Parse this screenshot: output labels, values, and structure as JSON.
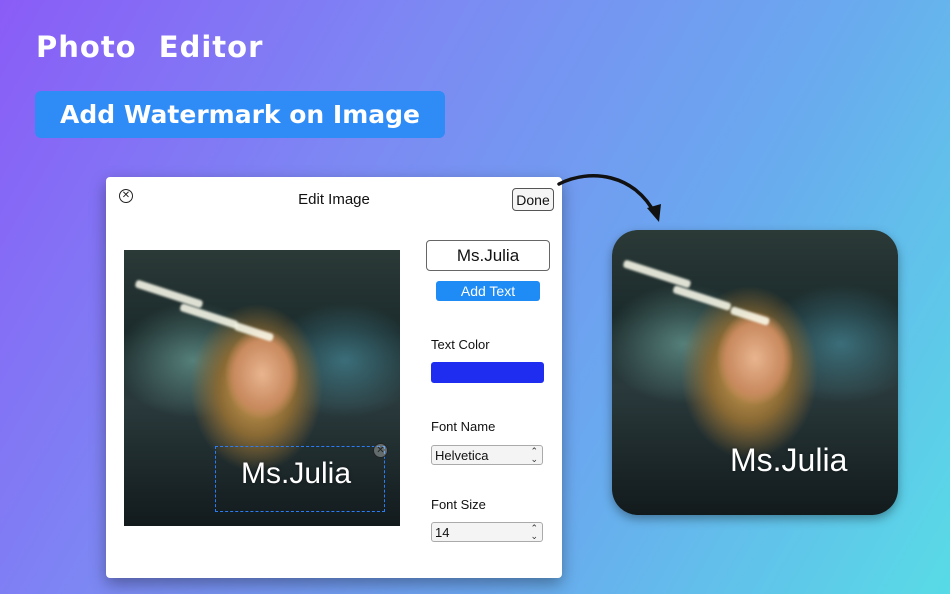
{
  "header": {
    "title": "Photo  Editor",
    "banner": "Add Watermark on Image"
  },
  "dialog": {
    "title": "Edit Image",
    "close_icon": "close-circle-icon",
    "done_label": "Done",
    "watermark_text": "Ms.Julia",
    "watermark_input_value": "Ms.Julia",
    "add_text_label": "Add Text",
    "text_color_label": "Text Color",
    "text_color": "#1f2df0",
    "font_name_label": "Font Name",
    "font_name_value": "Helvetica",
    "font_size_label": "Font Size",
    "font_size_value": "14"
  },
  "result": {
    "watermark_text": "Ms.Julia"
  },
  "colors": {
    "accent": "#2f8bf5",
    "button": "#1f8bf5",
    "selection": "#2a7df5"
  }
}
